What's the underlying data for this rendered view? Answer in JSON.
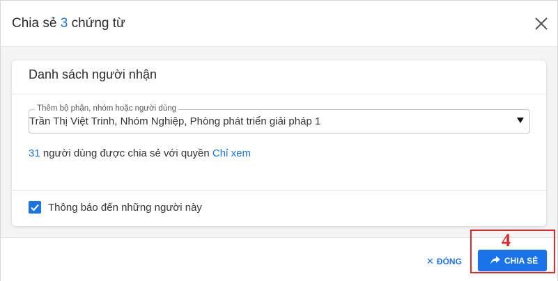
{
  "dialog": {
    "title_prefix": "Chia sẻ",
    "title_count": "3",
    "title_suffix": "chứng từ",
    "close_icon": "close-icon"
  },
  "recipients": {
    "section_title": "Danh sách người nhận",
    "field_label": "Thêm bộ phận, nhóm hoặc người dùng",
    "field_value": "Trần Thị Việt Trinh, Nhóm Nghiệp, Phòng phát triển giải pháp 1",
    "share_count": "31",
    "share_text": "người dùng được chia sẻ với quyền",
    "permission": "Chỉ xem"
  },
  "notify": {
    "checked": true,
    "label": "Thông báo đến những người này"
  },
  "footer": {
    "close_label": "ĐÓNG",
    "share_label": "CHIA SẺ"
  },
  "annotation": {
    "step": "4",
    "color": "#e12828"
  },
  "colors": {
    "accent": "#1a73e8"
  }
}
